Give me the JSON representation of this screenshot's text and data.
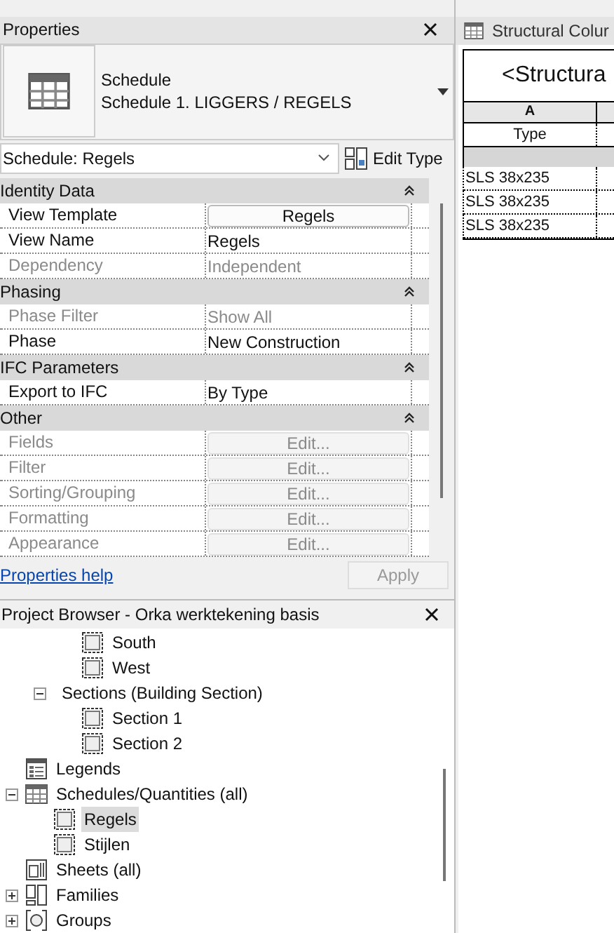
{
  "properties": {
    "title": "Properties",
    "type_selector": {
      "category": "Schedule",
      "name": "Schedule 1. LIGGERS / REGELS"
    },
    "instance_dropdown": "Schedule: Regels",
    "edit_type": "Edit Type",
    "groups": [
      {
        "title": "Identity Data",
        "rows": [
          {
            "label": "View Template",
            "value": "Regels",
            "kind": "button",
            "disabled": false
          },
          {
            "label": "View Name",
            "value": "Regels",
            "kind": "text",
            "disabled": false
          },
          {
            "label": "Dependency",
            "value": "Independent",
            "kind": "text",
            "disabled": true
          }
        ]
      },
      {
        "title": "Phasing",
        "rows": [
          {
            "label": "Phase Filter",
            "value": "Show All",
            "kind": "text",
            "disabled": true
          },
          {
            "label": "Phase",
            "value": "New Construction",
            "kind": "text",
            "disabled": false
          }
        ]
      },
      {
        "title": "IFC Parameters",
        "rows": [
          {
            "label": "Export to IFC",
            "value": "By Type",
            "kind": "text",
            "disabled": false
          }
        ]
      },
      {
        "title": "Other",
        "rows": [
          {
            "label": "Fields",
            "value": "Edit...",
            "kind": "button",
            "disabled": true
          },
          {
            "label": "Filter",
            "value": "Edit...",
            "kind": "button",
            "disabled": true
          },
          {
            "label": "Sorting/Grouping",
            "value": "Edit...",
            "kind": "button",
            "disabled": true
          },
          {
            "label": "Formatting",
            "value": "Edit...",
            "kind": "button",
            "disabled": true
          },
          {
            "label": "Appearance",
            "value": "Edit...",
            "kind": "button",
            "disabled": true
          }
        ]
      }
    ],
    "help_link": "Properties help",
    "apply": {
      "label": "Apply",
      "disabled": true
    }
  },
  "project_browser": {
    "title": "Project Browser - Orka werktekening basis",
    "tree": [
      {
        "kind": "hidden",
        "children": [
          {
            "kind": "hidden",
            "children": [
              {
                "label": "South",
                "kind": "view",
                "selected": false
              },
              {
                "label": "West",
                "kind": "view",
                "selected": false
              }
            ]
          },
          {
            "label": "Sections (Building Section)",
            "kind": "folder",
            "expanded": true,
            "children": [
              {
                "label": "Section 1",
                "kind": "view",
                "selected": false
              },
              {
                "label": "Section 2",
                "kind": "view",
                "selected": false
              }
            ]
          }
        ]
      },
      {
        "label": "Legends",
        "kind": "legend",
        "selected": false
      },
      {
        "label": "Schedules/Quantities (all)",
        "kind": "schedule",
        "expanded": true,
        "children": [
          {
            "label": "Regels",
            "kind": "view",
            "selected": true
          },
          {
            "label": "Stijlen",
            "kind": "view",
            "selected": false
          }
        ]
      },
      {
        "label": "Sheets (all)",
        "kind": "sheet",
        "selected": false
      },
      {
        "label": "Families",
        "kind": "family",
        "expanded": false
      },
      {
        "label": "Groups",
        "kind": "group",
        "expanded": false
      }
    ]
  },
  "schedule_view": {
    "tab_title": "Structural Colur",
    "title": "<Structura",
    "column_letter": "A",
    "column_header": "Type",
    "rows": [
      "SLS 38x235",
      "SLS 38x235",
      "SLS 38x235"
    ]
  }
}
